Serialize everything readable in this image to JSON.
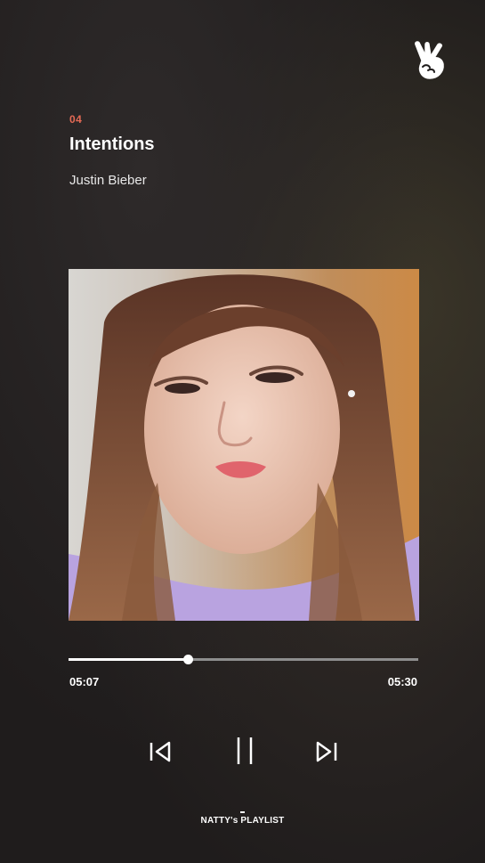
{
  "track": {
    "number": "04",
    "title": "Intentions",
    "artist": "Justin Bieber"
  },
  "player": {
    "elapsed": "05:07",
    "total": "05:30",
    "progress_fraction": 0.34
  },
  "controls": {
    "previous_icon": "skip-previous-icon",
    "pause_icon": "pause-icon",
    "next_icon": "skip-next-icon"
  },
  "footer": {
    "label": "NATTY's PLAYLIST"
  },
  "brand": {
    "logo_icon": "v-peace-hand-logo-icon"
  },
  "colors": {
    "track_number": "#e56a55",
    "background": "#1f1c1c",
    "progress_fill": "#ffffff",
    "progress_track": "#8e8e8e"
  }
}
